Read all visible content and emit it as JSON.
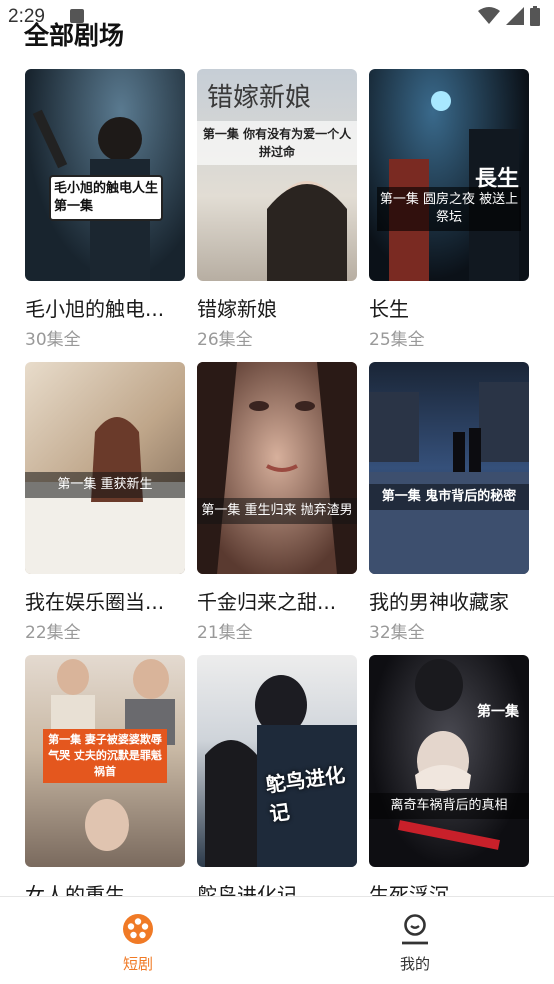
{
  "status": {
    "time": "2:29"
  },
  "header": {
    "title": "全部剧场"
  },
  "dramas": [
    {
      "title": "毛小旭的触电...",
      "count": "30集全",
      "overlay": "毛小旭的触电人生第一集",
      "palette": [
        "#2a4a5e",
        "#0f1c24"
      ]
    },
    {
      "title": "错嫁新娘",
      "count": "26集全",
      "overlay_top": "错嫁新娘",
      "overlay": "第一集 你有没有为爱一个人拼过命",
      "palette": [
        "#aeb9c4",
        "#d9d6cf"
      ]
    },
    {
      "title": "长生",
      "count": "25集全",
      "overlay_top": "長生",
      "overlay": "第一集 圆房之夜 被送上祭坛",
      "palette": [
        "#1c2f44",
        "#0a0f16"
      ]
    },
    {
      "title": "我在娱乐圈当...",
      "count": "22集全",
      "overlay": "第一集 重获新生",
      "palette": [
        "#d9cdb8",
        "#8a7460"
      ]
    },
    {
      "title": "千金归来之甜...",
      "count": "21集全",
      "overlay": "第一集 重生归来 抛弃渣男",
      "palette": [
        "#6a5048",
        "#2e2420"
      ]
    },
    {
      "title": "我的男神收藏家",
      "count": "32集全",
      "overlay": "第一集 鬼市背后的秘密",
      "palette": [
        "#2b3e5a",
        "#0d1420"
      ]
    },
    {
      "title": "女人的重生",
      "count": "",
      "overlay": "第一集 妻子被婆婆欺辱气哭 丈夫的沉默是罪魁祸首",
      "palette": [
        "#c9b49a",
        "#5a4636"
      ]
    },
    {
      "title": "鸵鸟进化记",
      "count": "",
      "overlay_top": "鸵鸟进化记",
      "overlay": "",
      "palette": [
        "#3a4a5c",
        "#1a2230"
      ]
    },
    {
      "title": "生死浮沉",
      "count": "",
      "overlay_top": "第一集",
      "overlay": "离奇车祸背后的真相",
      "palette": [
        "#2a2a2e",
        "#0c0c10"
      ]
    }
  ],
  "nav": [
    {
      "label": "短剧",
      "icon": "film-reel-icon",
      "active": true,
      "color": "#f07a26"
    },
    {
      "label": "我的",
      "icon": "user-icon",
      "active": false,
      "color": "#333333"
    }
  ]
}
